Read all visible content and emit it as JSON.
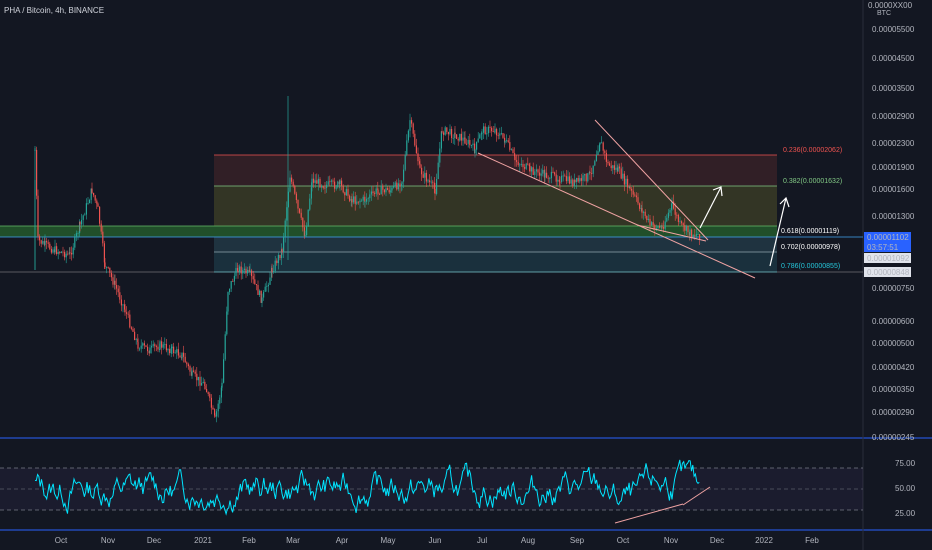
{
  "header": {
    "symbol_title": "PHA / Bitcoin, 4h, BINANCE"
  },
  "price_axis": {
    "unit": "BTC",
    "top_label": "0.0000XX00",
    "ticks": [
      "0.00005500",
      "0.00004500",
      "0.00003500",
      "0.00002900",
      "0.00002300",
      "0.00001900",
      "0.00001600",
      "0.00001300",
      "0.00000750",
      "0.00000600",
      "0.00000500",
      "0.00000420",
      "0.00000350",
      "0.00000290",
      "0.00000245"
    ],
    "last_price_tag": "0.00001102",
    "countdown_tag": "03:57:51",
    "tag_2": "0.00001092",
    "tag_3": "0.00000848"
  },
  "rsi_axis": {
    "ticks": [
      "75.00",
      "50.00",
      "25.00"
    ]
  },
  "time_axis": {
    "labels": [
      "Oct",
      "Nov",
      "Dec",
      "2021",
      "Feb",
      "Mar",
      "Apr",
      "May",
      "Jun",
      "Jul",
      "Aug",
      "Sep",
      "Oct",
      "Nov",
      "Dec",
      "2022",
      "Feb"
    ]
  },
  "fib_levels": [
    {
      "label": "0.236(0.00002062)",
      "color": "#ef5350"
    },
    {
      "label": "0.382(0.00001632)",
      "color": "#81c784"
    },
    {
      "label": "0.618(0.00001119)",
      "color": "#ffffff"
    },
    {
      "label": "0.702(0.00000978)",
      "color": "#ffffff"
    },
    {
      "label": "0.786(0.00000855)",
      "color": "#26c6da"
    }
  ],
  "colors": {
    "up": "#26a69a",
    "down": "#ef5350",
    "rsi": "#00e5ff",
    "bg": "#131722",
    "panel_line": "#2962ff"
  },
  "chart_data": {
    "type": "candlestick",
    "title": "PHA / Bitcoin, 4h, BINANCE",
    "ylabel": "BTC",
    "y_scale": "log",
    "ylim": [
      2.45e-06,
      5.5e-05
    ],
    "x_range": [
      "Sep 2020",
      "Feb 2022"
    ],
    "close_series": {
      "x": [
        "Sep 2020",
        "Oct 2020",
        "Nov 2020",
        "Dec 2020",
        "Jan 2021",
        "Feb 2021",
        "Mar 2021",
        "Apr 2021",
        "May 2021",
        "Jun 2021",
        "Jul 2021",
        "Aug 2021",
        "Sep 2021",
        "Oct 2021",
        "Nov 2021"
      ],
      "values": [
        1.1e-05,
        1.1e-05,
        6.2e-06,
        4.8e-06,
        3e-06,
        9.5e-06,
        1.75e-05,
        1.75e-05,
        1.85e-05,
        2.4e-05,
        2.35e-05,
        1.9e-05,
        1.8e-05,
        1.18e-05,
        1.12e-05
      ]
    },
    "fib_levels": [
      {
        "ratio": 0.236,
        "price": 2.062e-05
      },
      {
        "ratio": 0.382,
        "price": 1.632e-05
      },
      {
        "ratio": 0.618,
        "price": 1.119e-05
      },
      {
        "ratio": 0.702,
        "price": 9.78e-06
      },
      {
        "ratio": 0.786,
        "price": 8.55e-06
      }
    ],
    "rsi": {
      "ylim": [
        15,
        95
      ],
      "levels": [
        75,
        50,
        25
      ]
    },
    "grid": false
  }
}
